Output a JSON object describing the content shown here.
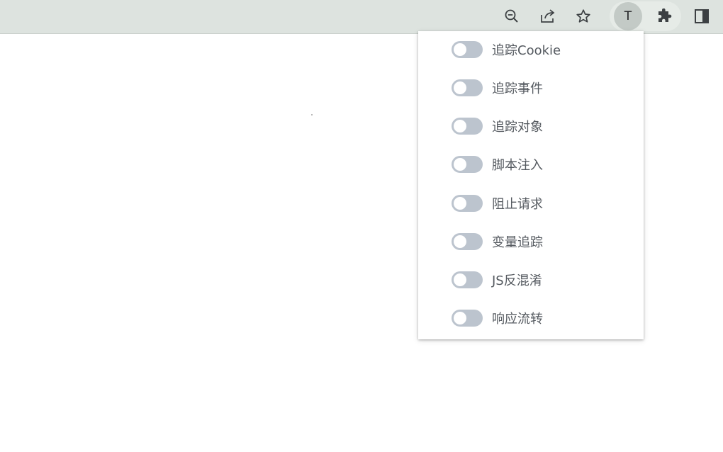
{
  "toolbar": {
    "buttons": [
      {
        "name": "zoom-out",
        "icon": "zoom-out-icon"
      },
      {
        "name": "share",
        "icon": "share-icon"
      },
      {
        "name": "bookmark",
        "icon": "star-icon"
      },
      {
        "name": "extension-t",
        "icon": "t-extension-icon",
        "letter": "T"
      },
      {
        "name": "extensions",
        "icon": "puzzle-icon"
      },
      {
        "name": "side-panel",
        "icon": "side-panel-icon"
      }
    ]
  },
  "panel": {
    "items": [
      {
        "label": "追踪Cookie",
        "enabled": false
      },
      {
        "label": "追踪事件",
        "enabled": false
      },
      {
        "label": "追踪对象",
        "enabled": false
      },
      {
        "label": "脚本注入",
        "enabled": false
      },
      {
        "label": "阻止请求",
        "enabled": false
      },
      {
        "label": "变量追踪",
        "enabled": false
      },
      {
        "label": "JS反混淆",
        "enabled": false
      },
      {
        "label": "响应流转",
        "enabled": false
      }
    ]
  },
  "colors": {
    "toolbar_bg": "#dde3df",
    "switch_off": "#bcc4ce",
    "label_text": "#555a60",
    "icon": "#3c4043"
  }
}
